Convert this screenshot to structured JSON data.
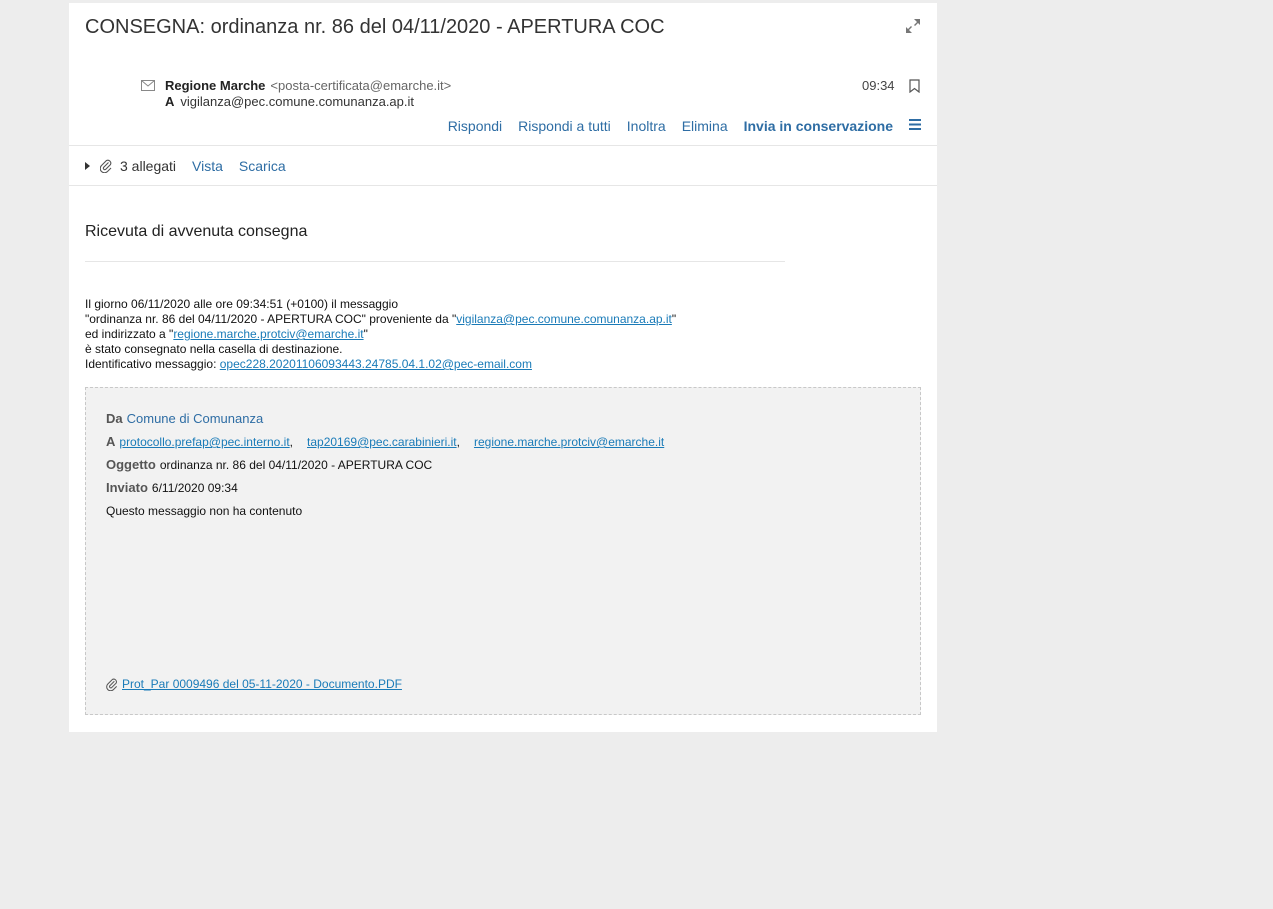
{
  "message": {
    "subject": "CONSEGNA: ordinanza nr. 86 del 04/11/2020 - APERTURA COC",
    "sender_name": "Regione Marche",
    "sender_address": "<posta-certificata@emarche.it>",
    "to_label": "A",
    "to_address": "vigilanza@pec.comune.comunanza.ap.it",
    "time": "09:34"
  },
  "actions": {
    "reply": "Rispondi",
    "reply_all": "Rispondi a tutti",
    "forward": "Inoltra",
    "delete": "Elimina",
    "archive": "Invia in conservazione"
  },
  "attachments": {
    "count_label": "3 allegati",
    "view": "Vista",
    "download": "Scarica"
  },
  "receipt": {
    "title": "Ricevuta di avvenuta consegna",
    "line1": "Il giorno 06/11/2020 alle ore 09:34:51 (+0100) il messaggio",
    "line2_a": "\"ordinanza nr. 86 del 04/11/2020 - APERTURA COC\" proveniente da \"",
    "line2_link": "vigilanza@pec.comune.comunanza.ap.it",
    "line2_b": "\"",
    "line3_a": "ed indirizzato a \"",
    "line3_link": "regione.marche.protciv@emarche.it",
    "line3_b": "\"",
    "line4": "è stato consegnato nella casella di destinazione.",
    "line5_a": "Identificativo messaggio: ",
    "line5_link": "opec228.20201106093443.24785.04.1.02@pec-email.com"
  },
  "original": {
    "from_label": "Da",
    "from_value": "Comune di Comunanza",
    "to_label": "A",
    "to_list": [
      "protocollo.prefap@pec.interno.it",
      "tap20169@pec.carabinieri.it",
      "regione.marche.protciv@emarche.it"
    ],
    "separator": ",",
    "subject_label": "Oggetto",
    "subject_value": "ordinanza nr. 86 del 04/11/2020 - APERTURA COC",
    "sent_label": "Inviato",
    "sent_value": "6/11/2020 09:34",
    "no_content": "Questo messaggio non ha contenuto",
    "attachment_name": "Prot_Par 0009496 del 05-11-2020 - Documento.PDF"
  },
  "icons": {
    "expand": "expand-icon",
    "envelope": "envelope-icon",
    "bookmark": "bookmark-icon",
    "menu": "hamburger-menu-icon",
    "caret": "caret-right-icon",
    "paperclip": "paperclip-icon"
  },
  "colors": {
    "link": "#2e6da4",
    "hyperlink": "#1a7bb8",
    "background": "#ededed"
  }
}
